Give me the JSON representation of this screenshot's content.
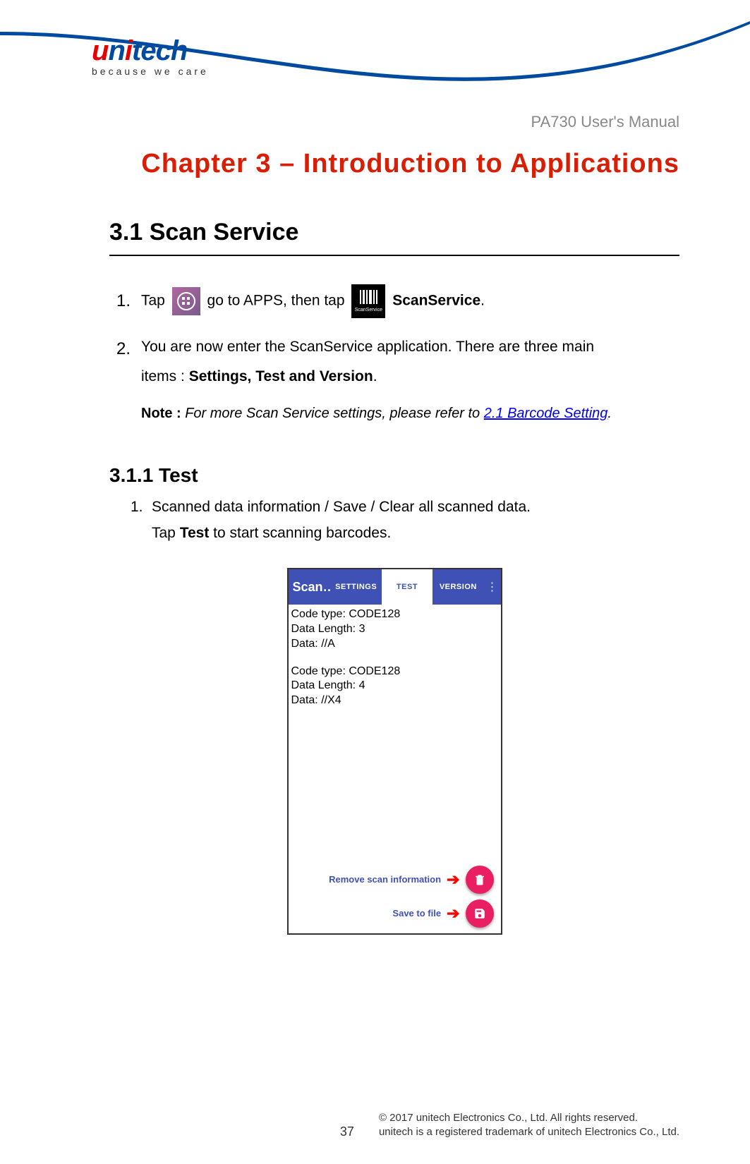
{
  "brand": {
    "name": "unitech",
    "tagline": "because we care"
  },
  "doc_title": "PA730 User's Manual",
  "chapter_title": "Chapter 3 – Introduction to Applications",
  "section_title": "3.1 Scan Service",
  "steps": [
    {
      "num": "1.",
      "t1": "Tap ",
      "t2": " go to APPS, then tap ",
      "t3": " ScanService",
      "t4": "."
    },
    {
      "num": "2.",
      "line1a": "You are now enter the ScanService application. There are three main",
      "line2a": "items : ",
      "line2b": "Settings, Test and Version",
      "line2c": "."
    }
  ],
  "note": {
    "label": "Note : ",
    "body_pre": "For more Scan Service settings, please refer to ",
    "link": "2.1 Barcode Setting",
    "body_post": "."
  },
  "subsection_title": "3.1.1 Test",
  "sub_item": {
    "num": "1.",
    "line1": "Scanned data information / Save / Clear all scanned data.",
    "line2a": "Tap ",
    "line2b": "Test",
    "line2c": " to start scanning barcodes."
  },
  "mock": {
    "app_name": "Scan…",
    "tabs": [
      "SETTINGS",
      "TEST",
      "VERSION"
    ],
    "blocks": [
      {
        "type": "Code type: CODE128",
        "len": "Data Length: 3",
        "data": "Data: //A"
      },
      {
        "type": "Code type: CODE128",
        "len": "Data Length: 4",
        "data": "Data: //X4"
      }
    ],
    "fab": {
      "remove_label": "Remove scan information",
      "save_label": "Save to file"
    }
  },
  "footer": {
    "page": "37",
    "line1": "© 2017 unitech Electronics Co., Ltd. All rights reserved.",
    "line2": "unitech is a registered trademark of unitech Electronics Co., Ltd."
  }
}
